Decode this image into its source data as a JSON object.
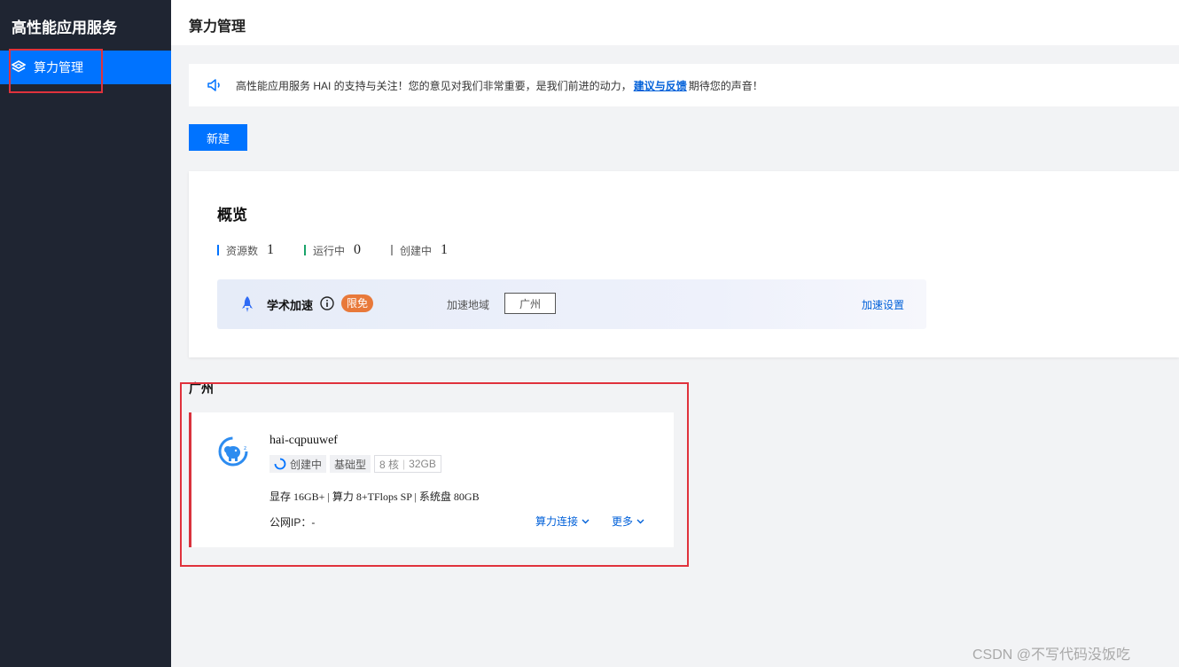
{
  "sidebar": {
    "app_title": "高性能应用服务",
    "items": [
      {
        "label": "算力管理",
        "icon": "compute-layers-icon",
        "active": true
      }
    ]
  },
  "header": {
    "title": "算力管理"
  },
  "notice": {
    "text_before": "高性能应用服务 HAI 的支持与关注！您的意见对我们非常重要，是我们前进的动力，",
    "link": "建议与反馈",
    "text_after": "期待您的声音！"
  },
  "toolbar": {
    "new_label": "新建"
  },
  "overview": {
    "title": "概览",
    "stats": [
      {
        "label": "资源数",
        "value": "1",
        "color": "#0073ff"
      },
      {
        "label": "运行中",
        "value": "0",
        "color": "#1aa36a"
      },
      {
        "label": "创建中",
        "value": "1",
        "color": "#999999"
      }
    ],
    "academic": {
      "label": "学术加速",
      "badge": "限免",
      "region_label": "加速地域",
      "region_value": "广州",
      "settings_link": "加速设置"
    }
  },
  "region": {
    "title": "广州",
    "instance": {
      "name": "hai-cqpuuwef",
      "status": "创建中",
      "type": "基础型",
      "cores": "8 核",
      "memory": "32GB",
      "specs": "显存 16GB+ | 算力 8+TFlops SP | 系统盘 80GB",
      "ip": "公网IP：-",
      "action_connect": "算力连接",
      "action_more": "更多"
    }
  },
  "watermark": "CSDN @不写代码没饭吃"
}
